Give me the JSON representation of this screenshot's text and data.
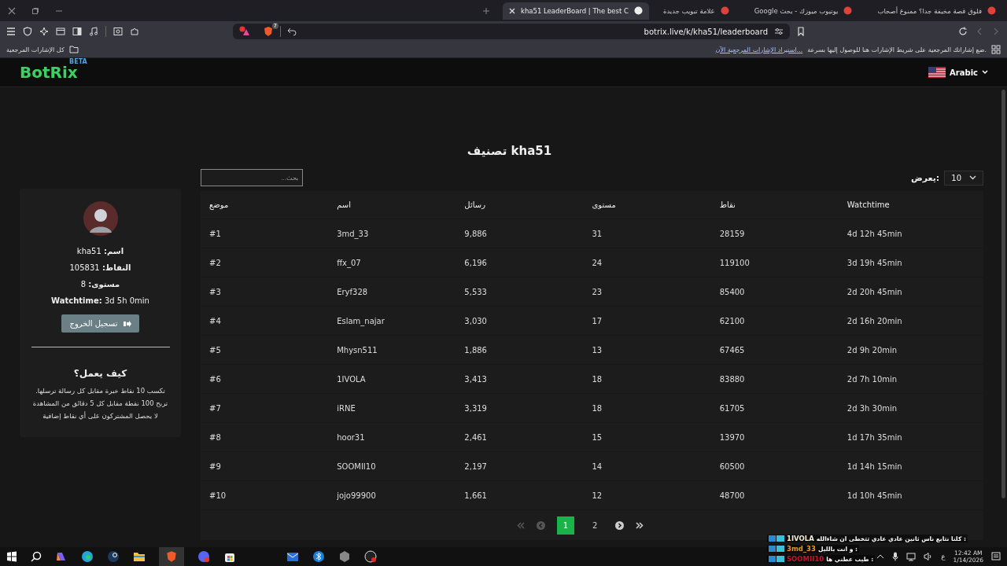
{
  "browser": {
    "tabs": [
      {
        "title": "فلوق قصة مخيفة جدا؟ ممنوع أصحاب",
        "selected": false
      },
      {
        "title": "يوتيوب ميوزك - بحث Google",
        "selected": false
      },
      {
        "title": "علامة تبويب جديدة",
        "selected": false
      },
      {
        "title": "kha51 LeaderBoard | The best C",
        "selected": true
      }
    ],
    "shields_count": "7",
    "url": "botrix.live/k/kha51/leaderboard",
    "bookmarks": {
      "all_bookmarks": "كل الإشارات المرجعية",
      "hint": "ضع إشاراتك المرجعية على شريط الإشارات هنا للوصول إليها بسرعة.",
      "import_link": "استيراد الإشارات المرجعية الآن..."
    }
  },
  "site_header": {
    "logo": "BotRix",
    "badge": "BETA",
    "language": "Arabic"
  },
  "profile": {
    "lines": [
      "**اسم:** kha51",
      "**النقاط:** 105831",
      "**مستوى:** 8",
      "**Watchtime:** 3d 5h 0min"
    ],
    "logout_button": "تسجيل الخروج",
    "how_title": "كيف يعمل؟",
    "how_lines": [
      "تكسب 10 نقاط خبرة مقابل كل رسالة ترسلها.",
      "تربح 100 نقطة مقابل كل 5 دقائق من المشاهدة",
      "لا يحصل المشتركون على أي نقاط إضافية"
    ]
  },
  "leaderboard": {
    "title": "تصنيف kha51",
    "search": {
      "placeholder": "بحث..."
    },
    "show_label": "يعرض:",
    "page_size": "10",
    "columns": [
      "Watchtime",
      "نقاط",
      "مستوى",
      "رسائل",
      "اسم",
      "موضع"
    ],
    "rows": [
      [
        "4d 12h 45min",
        "28159",
        "31",
        "9,886",
        "3md_33",
        "#1"
      ],
      [
        "3d 19h 45min",
        "119100",
        "24",
        "6,196",
        "ffx_07",
        "#2"
      ],
      [
        "2d 20h 45min",
        "85400",
        "23",
        "5,533",
        "Eryf328",
        "#3"
      ],
      [
        "2d 16h 20min",
        "62100",
        "17",
        "3,030",
        "Eslam_najar",
        "#4"
      ],
      [
        "2d 9h 20min",
        "67465",
        "13",
        "1,886",
        "Mhysn511",
        "#5"
      ],
      [
        "2d 7h 10min",
        "83880",
        "18",
        "3,413",
        "1IVOLA",
        "#6"
      ],
      [
        "2d 3h 30min",
        "61705",
        "18",
        "3,319",
        "iRNE",
        "#7"
      ],
      [
        "1d 17h 35min",
        "13970",
        "15",
        "2,461",
        "hoor31",
        "#8"
      ],
      [
        "1d 14h 15min",
        "60500",
        "14",
        "2,197",
        "SOOMII10",
        "#9"
      ],
      [
        "1d 10h 45min",
        "48700",
        "12",
        "1,661",
        "jojo99900",
        "#10"
      ]
    ],
    "pagination": [
      {
        "kind": "last",
        "disabled": false
      },
      {
        "kind": "next",
        "disabled": false
      },
      {
        "kind": "page",
        "label": "2",
        "selected": false
      },
      {
        "kind": "page",
        "label": "1",
        "selected": true
      },
      {
        "kind": "prev",
        "disabled": true
      },
      {
        "kind": "first",
        "disabled": true
      }
    ]
  },
  "chat": [
    {
      "user": "1IVOLA",
      "color": "#f2e9d0",
      "message": ": كلنا نتابع ناس ثانين عادي عادي تتخطى ان شاءالله"
    },
    {
      "user": "3md_33",
      "color": "#e8962e",
      "message": ": و انت بالليل"
    },
    {
      "user": "SOOMII10",
      "color": "#d0102a",
      "message": ": طيب عطني ها"
    }
  ],
  "taskbar": {
    "language": "ع",
    "time": "12:42 AM",
    "date": "1/14/2026"
  }
}
